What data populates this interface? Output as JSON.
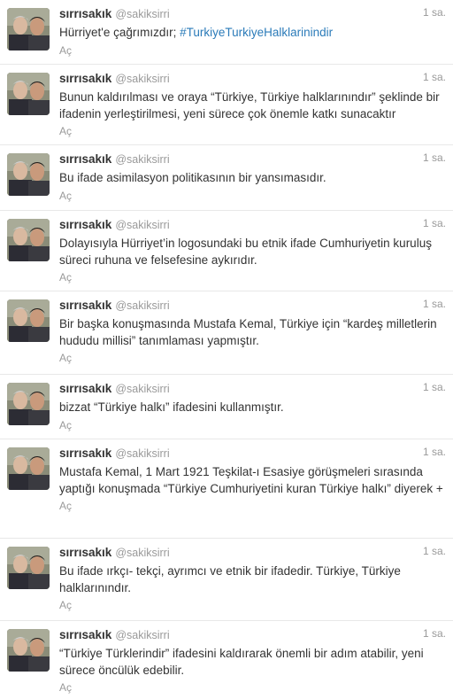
{
  "colors": {
    "name": "#333333",
    "muted": "#999999",
    "link": "#2b7bb9",
    "divider": "#e8e8e8"
  },
  "icons": {
    "avatar": "profile-photo-two-men"
  },
  "tweets": [
    {
      "name": "sırrısakık",
      "handle": "@sakiksirri",
      "time": "1 sa.",
      "text": "Hürriyet'e çağrımızdır; ",
      "hashtag": "#TurkiyeTurkiyeHalklarinindir",
      "expand": "Aç"
    },
    {
      "name": "sırrısakık",
      "handle": "@sakiksirri",
      "time": "1 sa.",
      "text": "Bunun kaldırılması ve oraya “Türkiye, Türkiye halklarınındır” şeklinde bir ifadenin yerleştirilmesi, yeni sürece çok önemle katkı sunacaktır",
      "expand": "Aç"
    },
    {
      "name": "sırrısakık",
      "handle": "@sakiksirri",
      "time": "1 sa.",
      "text": "Bu ifade asimilasyon politikasının bir yansımasıdır.",
      "expand": "Aç"
    },
    {
      "name": "sırrısakık",
      "handle": "@sakiksirri",
      "time": "1 sa.",
      "text": "Dolayısıyla Hürriyet’in logosundaki bu etnik ifade Cumhuriyetin kuruluş süreci ruhuna ve felsefesine aykırıdır.",
      "expand": "Aç"
    },
    {
      "name": "sırrısakık",
      "handle": "@sakiksirri",
      "time": "1 sa.",
      "text": "Bir başka konuşmasında Mustafa Kemal, Türkiye için “kardeş milletlerin hududu millisi” tanımlaması yapmıştır.",
      "expand": "Aç"
    },
    {
      "name": "sırrısakık",
      "handle": "@sakiksirri",
      "time": "1 sa.",
      "text": "bizzat “Türkiye halkı” ifadesini kullanmıştır.",
      "expand": "Aç"
    },
    {
      "name": "sırrısakık",
      "handle": "@sakiksirri",
      "time": "1 sa.",
      "text": "Mustafa Kemal, 1 Mart 1921 Teşkilat-ı Esasiye görüşmeleri sırasında yaptığı konuşmada “Türkiye Cumhuriyetini kuran Türkiye halkı” diyerek +",
      "expand": "Aç"
    },
    {
      "name": "sırrısakık",
      "handle": "@sakiksirri",
      "time": "1 sa.",
      "text": "Bu ifade ırkçı- tekçi, ayrımcı ve etnik bir ifadedir. Türkiye, Türkiye halklarınındır.",
      "expand": "Aç"
    },
    {
      "name": "sırrısakık",
      "handle": "@sakiksirri",
      "time": "1 sa.",
      "text": "“Türkiye Türklerindir” ifadesini kaldırarak önemli bir adım atabilir, yeni sürece öncülük edebilir.",
      "expand": "Aç"
    }
  ]
}
